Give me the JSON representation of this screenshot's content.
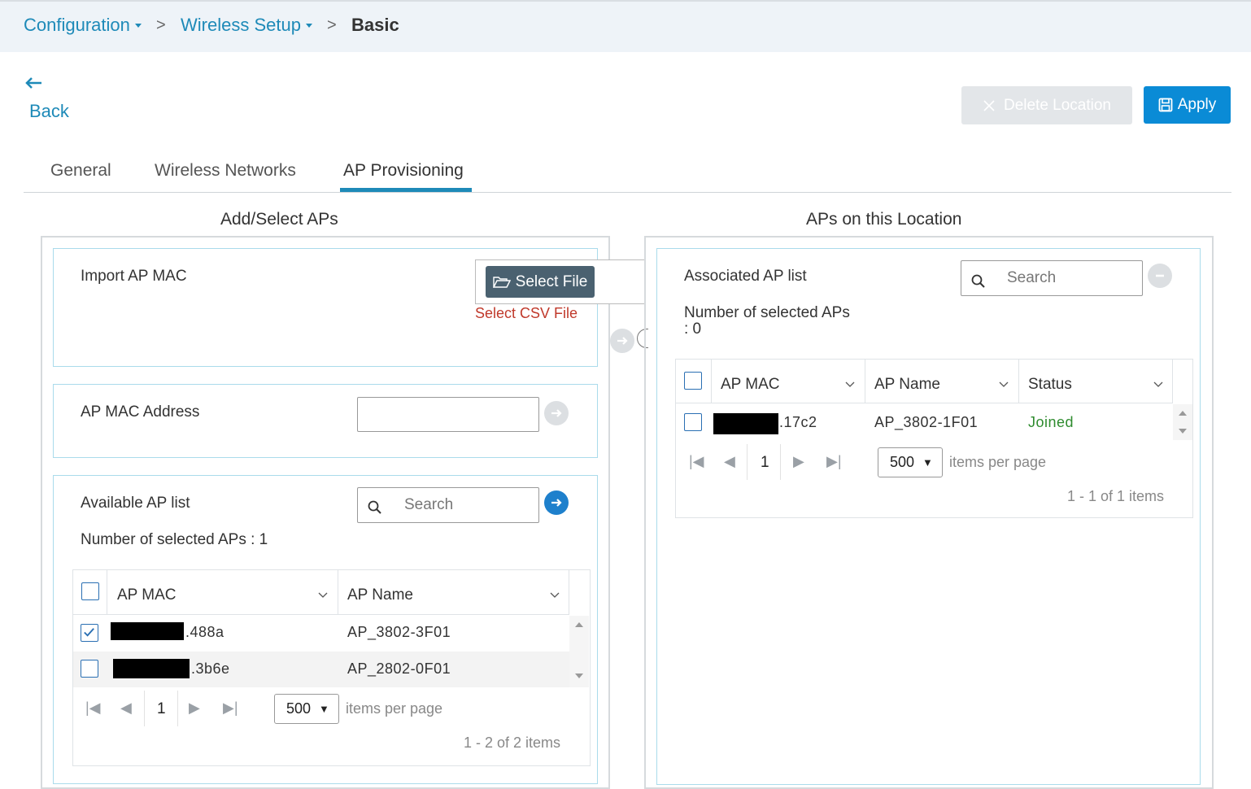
{
  "breadcrumb": {
    "items": [
      "Configuration",
      "Wireless Setup"
    ],
    "current": "Basic",
    "separator": ">"
  },
  "back": {
    "label": "Back"
  },
  "actions": {
    "delete_label": "Delete Location",
    "apply_label": "Apply"
  },
  "tabs": [
    {
      "label": "General"
    },
    {
      "label": "Wireless Networks"
    },
    {
      "label": "AP Provisioning"
    }
  ],
  "left": {
    "title": "Add/Select APs",
    "import": {
      "label": "Import AP MAC",
      "button": "Select File",
      "hint": "Select CSV File"
    },
    "mac_address": {
      "label": "AP MAC Address",
      "value": ""
    },
    "available": {
      "label": "Available AP list",
      "search_placeholder": "Search",
      "selected_count": "Number of selected APs : 1",
      "columns": [
        "AP MAC",
        "AP Name"
      ],
      "rows": [
        {
          "mac": ".488a",
          "name": "AP_3802-3F01",
          "checked": true
        },
        {
          "mac": ".3b6e",
          "name": "AP_2802-0F01",
          "checked": false
        }
      ],
      "page": "1",
      "page_size": "500",
      "items_per_page": "items per page",
      "count": "1 - 2 of 2 items"
    }
  },
  "right": {
    "title": "APs on this Location",
    "associated": {
      "label": "Associated AP list",
      "search_placeholder": "Search",
      "selected_count_line1": "Number of selected APs",
      "selected_count_line2": ": 0",
      "columns": [
        "AP MAC",
        "AP Name",
        "Status"
      ],
      "rows": [
        {
          "mac": ".17c2",
          "name": "AP_3802-1F01",
          "status": "Joined"
        }
      ],
      "page": "1",
      "page_size": "500",
      "items_per_page": "items per page",
      "count": "1 - 1 of 1 items"
    }
  },
  "colors": {
    "accent": "#1e8ab8",
    "primary": "#0a8bd6",
    "joined": "#2e8b2e",
    "hint": "#c0392b"
  }
}
